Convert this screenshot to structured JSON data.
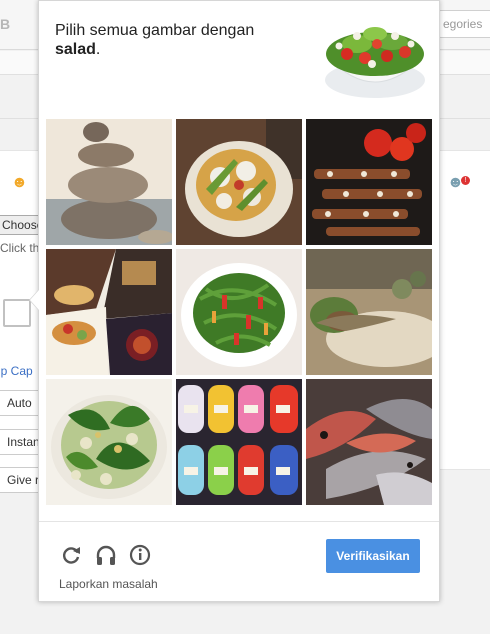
{
  "background_page": {
    "logo_fragment": "B",
    "categories_fragment": "egories",
    "choose_fragment": "Choose",
    "click_fragment": "Click th",
    "skip_fragment": "ip Cap",
    "auto_fragment": "Auto",
    "instant_fragment": "Instan",
    "give_fragment": "Give r"
  },
  "captcha": {
    "prompt_line1": "Pilih semua gambar dengan",
    "prompt_target": "salad",
    "prompt_suffix": ".",
    "reference_image": "salad-bowl",
    "tiles": [
      {
        "subject": "stacked-stones"
      },
      {
        "subject": "salad-plate"
      },
      {
        "subject": "grilled-skewers"
      },
      {
        "subject": "restaurant-collage"
      },
      {
        "subject": "noodle-salad"
      },
      {
        "subject": "fish-dish"
      },
      {
        "subject": "leafy-salad"
      },
      {
        "subject": "yarn-balls"
      },
      {
        "subject": "raw-fish"
      }
    ],
    "footer": {
      "reload_icon": "reload-icon",
      "audio_icon": "headphones-icon",
      "info_icon": "info-icon",
      "report_label": "Laporkan masalah",
      "verify_label": "Verifikasikan"
    },
    "colors": {
      "verify_button": "#4a90e2",
      "icon": "#555555"
    }
  }
}
